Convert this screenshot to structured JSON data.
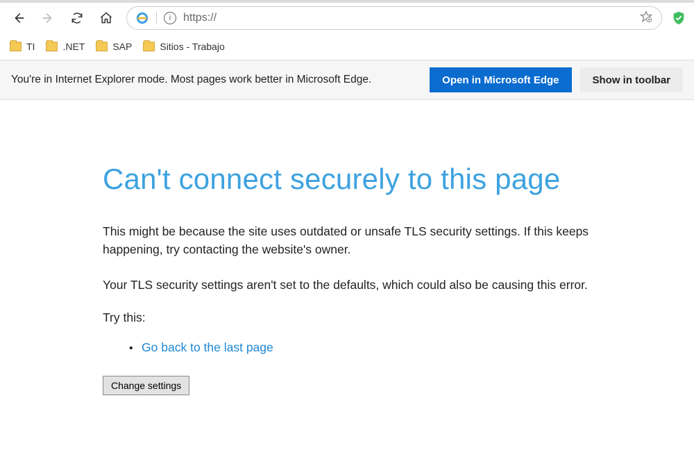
{
  "addressbar": {
    "url_value": "https://"
  },
  "bookmarks": [
    "TI",
    ".NET",
    "SAP",
    "Sitios - Trabajo"
  ],
  "notification": {
    "message": "You're in Internet Explorer mode. Most pages work better in Microsoft Edge.",
    "open_btn": "Open in Microsoft Edge",
    "toolbar_btn": "Show in toolbar"
  },
  "error": {
    "title": "Can't connect securely to this page",
    "para1": "This might be because the site uses outdated or unsafe TLS security settings. If this keeps happening, try contacting the website's owner.",
    "para2": "Your TLS security settings aren't set to the defaults, which could also be causing this error.",
    "try_label": "Try this:",
    "link": "Go back to the last page",
    "button": "Change settings"
  }
}
